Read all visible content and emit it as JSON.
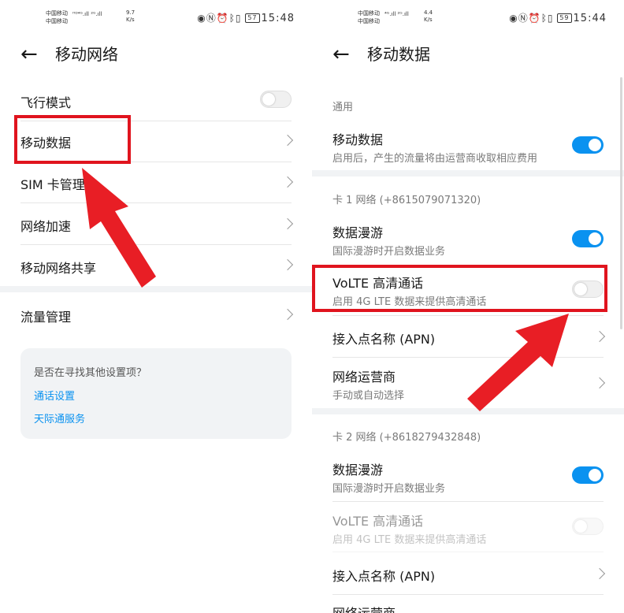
{
  "left": {
    "status": {
      "carrier1": "中国移动",
      "carrier2": "中国移动",
      "speed": "9.7",
      "speed_unit": "K/s",
      "battery": "57",
      "time": "15:48"
    },
    "title": "移动网络",
    "items": [
      {
        "label": "飞行模式"
      },
      {
        "label": "移动数据"
      },
      {
        "label": "SIM 卡管理"
      },
      {
        "label": "网络加速"
      },
      {
        "label": "移动网络共享"
      },
      {
        "label": "流量管理"
      }
    ],
    "card": {
      "title": "是否在寻找其他设置项？",
      "link1": "通话设置",
      "link2": "天际通服务"
    }
  },
  "right": {
    "status": {
      "carrier1": "中国移动",
      "carrier2": "中国移动",
      "speed": "4.4",
      "speed_unit": "K/s",
      "battery": "59",
      "time": "15:44"
    },
    "title": "移动数据",
    "general_header": "通用",
    "mobile_data": {
      "label": "移动数据",
      "desc": "启用后，产生的流量将由运营商收取相应费用"
    },
    "sim1": {
      "header": "卡 1 网络 (+8615079071320)",
      "roaming": {
        "label": "数据漫游",
        "desc": "国际漫游时开启数据业务"
      },
      "volte": {
        "label": "VoLTE 高清通话",
        "desc": "启用 4G LTE 数据来提供高清通话"
      },
      "apn": {
        "label": "接入点名称 (APN)"
      },
      "operator": {
        "label": "网络运营商",
        "desc": "手动或自动选择"
      }
    },
    "sim2": {
      "header": "卡 2 网络 (+8618279432848)",
      "roaming": {
        "label": "数据漫游",
        "desc": "国际漫游时开启数据业务"
      },
      "volte": {
        "label": "VoLTE 高清通话",
        "desc": "启用 4G LTE 数据来提供高清通话"
      },
      "apn": {
        "label": "接入点名称 (APN)"
      },
      "operator": {
        "label": "网络运营商"
      }
    }
  },
  "colors": {
    "accent": "#0a92f0",
    "highlight": "#e0141e"
  }
}
